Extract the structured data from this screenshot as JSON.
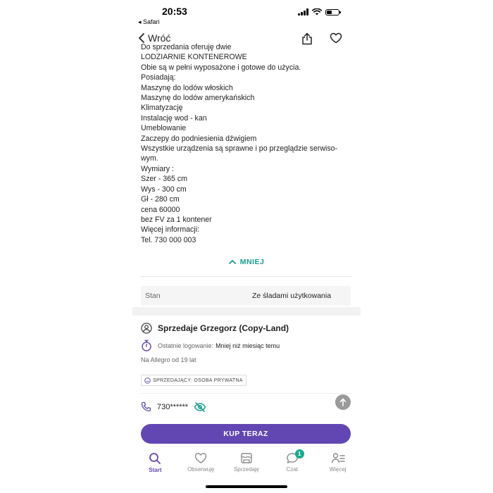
{
  "status_bar": {
    "time": "20:53",
    "back_to_app": "◂ Safari"
  },
  "nav": {
    "back_label": "Wróć"
  },
  "description": {
    "lines": [
      "Do sprzedania oferuję dwie",
      "LODZIARNIE KONTENEROWE",
      "Obie są w pełni wyposażone i gotowe do użycia.",
      "Posiadają:",
      "Maszynę do lodów włoskich",
      "Maszynę do lodów amerykańskich",
      "Klimatyzację",
      "Instalację wod - kan",
      "Umeblowanie",
      "Zaczepy do podniesienia dźwigiem",
      "Wszystkie urządzenia są sprawne i po przeglądzie serwiso-",
      "wym.",
      "Wymiary :",
      "Szer - 365 cm",
      "Wys - 300 cm",
      "Gł - 280 cm",
      "cena 60000",
      "bez FV za 1 kontener",
      "Więcej informacji:",
      "Tel. 730 000 003"
    ],
    "less_label": "MNIEJ"
  },
  "params": {
    "condition_key": "Stan",
    "condition_value": "Ze śladami użytkowania"
  },
  "seller": {
    "name": "Sprzedaje Grzegorz (Copy-Land)",
    "last_login_label": "Ostatnie logowanie:",
    "last_login_value": "Mniej niż miesiąc temu",
    "since": "Na Allegro od 19 lat",
    "badge": "SPRZEDAJĄCY: OSOBA PRYWATNA",
    "phone_masked": "730******"
  },
  "buy_button": {
    "label": "KUP TERAZ"
  },
  "tabbar": {
    "start": "Start",
    "watch": "Obserwuję",
    "sell": "Sprzedaję",
    "chat": "Czat",
    "chat_badge": "1",
    "more": "Więcej"
  },
  "colors": {
    "accent": "#6247b3",
    "teal": "#1a9c8c",
    "badge": "#1aa98d"
  }
}
